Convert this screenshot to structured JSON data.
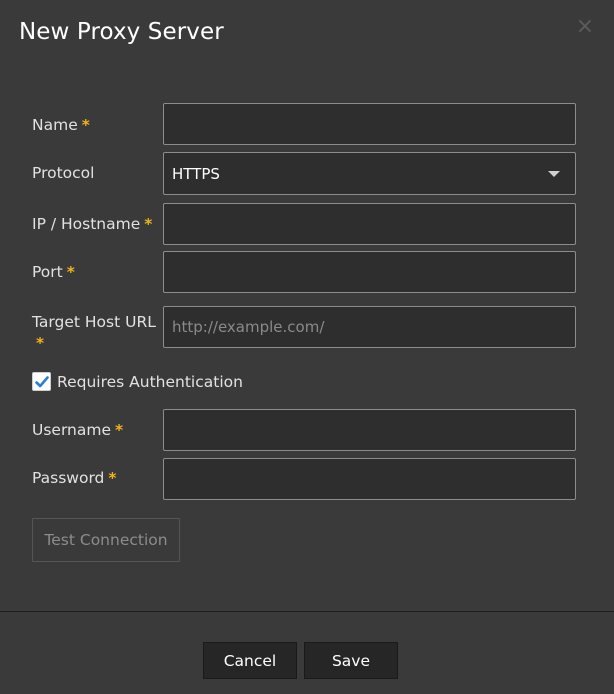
{
  "dialog": {
    "title": "New Proxy Server",
    "close_glyph": "×"
  },
  "form": {
    "required_marker": "*",
    "name": {
      "label": "Name",
      "value": "",
      "placeholder": ""
    },
    "protocol": {
      "label": "Protocol",
      "value": "HTTPS"
    },
    "hostname": {
      "label": "IP / Hostname",
      "value": "",
      "placeholder": ""
    },
    "port": {
      "label": "Port",
      "value": "",
      "placeholder": ""
    },
    "target_host_url": {
      "label": "Target Host URL",
      "value": "",
      "placeholder": "http://example.com/"
    },
    "requires_auth": {
      "label": "Requires Authentication",
      "checked": true
    },
    "username": {
      "label": "Username",
      "value": "",
      "placeholder": ""
    },
    "password": {
      "label": "Password",
      "value": "",
      "placeholder": ""
    },
    "test_connection_label": "Test Connection"
  },
  "footer": {
    "cancel_label": "Cancel",
    "save_label": "Save"
  },
  "colors": {
    "background": "#3a3a3a",
    "field_background": "#2e2e2e",
    "required_asterisk": "#f0b418",
    "checkbox_check": "#2a7fd4",
    "button_background": "#262626"
  },
  "icons": {
    "close": "close-icon",
    "dropdown": "chevron-down-icon",
    "checkbox": "checkmark-icon"
  }
}
